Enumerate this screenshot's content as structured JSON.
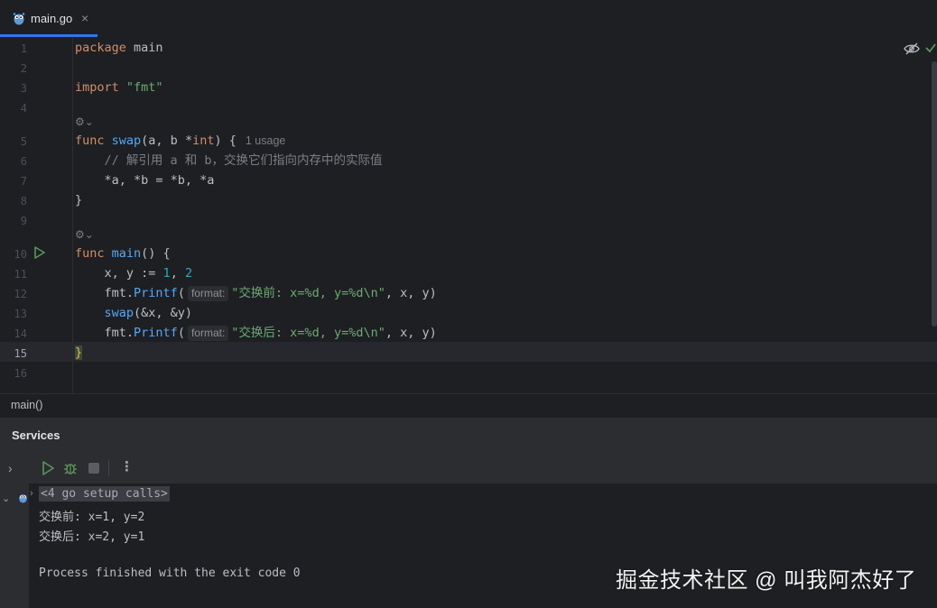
{
  "tab": {
    "filename": "main.go",
    "close_glyph": "×"
  },
  "editor": {
    "line_numbers": [
      "1",
      "2",
      "3",
      "4",
      "5",
      "6",
      "7",
      "8",
      "9",
      "10",
      "11",
      "12",
      "13",
      "14",
      "15",
      "16"
    ],
    "current_line": "15",
    "gen_hint": "⚙⌄",
    "lines": {
      "l1": {
        "kw": "package",
        "rest": " main"
      },
      "l3": {
        "kw": "import",
        "sp": " ",
        "str": "\"fmt\""
      },
      "l5": {
        "kw": "func",
        "sp": " ",
        "fn": "swap",
        "params": "(a, b *",
        "type": "int",
        "close": ") {",
        "usage": "1 usage"
      },
      "l6": {
        "comment": "    // 解引用 a 和 b，交换它们指向内存中的实际值"
      },
      "l7": {
        "code": "    *a, *b = *b, *a"
      },
      "l8": {
        "code": "}"
      },
      "l10": {
        "kw": "func",
        "sp": " ",
        "fn": "main",
        "close": "() {"
      },
      "l11": {
        "pre": "    x, y := ",
        "n1": "1",
        "comma": ", ",
        "n2": "2"
      },
      "l12": {
        "pre": "    fmt.",
        "fn": "Printf",
        "open": "(",
        "hint": "format:",
        "str": "\"交换前: x=%d, y=%d\\n\"",
        "rest": ", x, y)"
      },
      "l13": {
        "pre": "    ",
        "fn": "swap",
        "rest": "(&x, &y)"
      },
      "l14": {
        "pre": "    fmt.",
        "fn": "Printf",
        "open": "(",
        "hint": "format:",
        "str": "\"交换后: x=%d, y=%d\\n\"",
        "rest": ", x, y)"
      },
      "l15": {
        "code": "}"
      }
    }
  },
  "breadcrumb": "main()",
  "services": {
    "title": "Services",
    "console": {
      "setup": "<4 go setup calls>",
      "line1": "交换前: x=1, y=2",
      "line2": "交换后: x=2, y=1",
      "line3": "Process finished with the exit code 0"
    }
  },
  "watermark": "掘金技术社区 @ 叫我阿杰好了",
  "icons": {
    "tab": "gopher-icon",
    "run_gutter": "run-icon",
    "inspect": "eye-off-icon",
    "status": "check-icon",
    "toolbar": [
      "run-icon",
      "debug-icon",
      "stop-icon",
      "more-icon"
    ]
  },
  "colors": {
    "background": "#1e1f22",
    "panel": "#2b2d30",
    "keyword": "#cf8e6d",
    "function": "#56a8f5",
    "string": "#6aab73",
    "number": "#2aacb8",
    "comment": "#7a7e85",
    "accent": "#3574f0",
    "run_green": "#57965c"
  }
}
